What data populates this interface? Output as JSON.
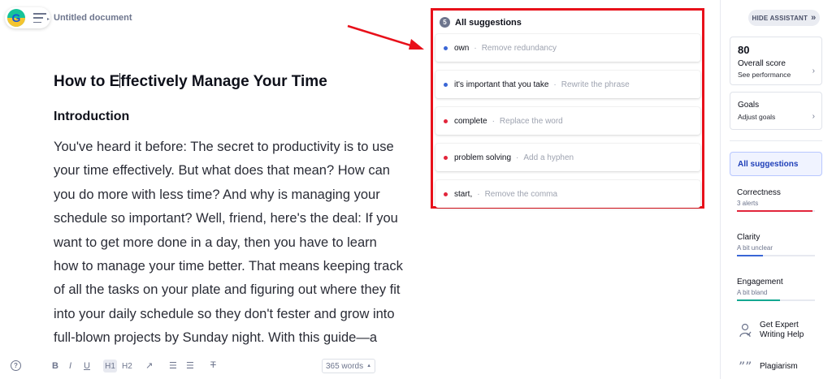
{
  "header": {
    "doc_title": "Untitled document"
  },
  "document": {
    "heading_before_caret": "How to E",
    "heading_after_caret": "ffectively Manage Your Time",
    "subheading": "Introduction",
    "paragraph": "You've heard it before: The secret to productivity is to use your time effectively. But what does that mean? How can you do more with less time? And why is managing your schedule so important? Well, friend, here's the deal: If you want to get more done in a day, then you have to learn how to manage your time better. That means keeping track of all the tasks on your plate and figuring out where they fit into your daily schedule so they don't fester and grow into full-blown projects by Sunday night. With this guide—a compilation of tips collected from"
  },
  "toolbar": {
    "help": "?",
    "bold": "B",
    "italic": "I",
    "underline": "U",
    "h1": "H1",
    "h2": "H2",
    "link_icon": "↗",
    "ordered_list": "☰",
    "bullet_list": "☰",
    "clear_format": "T",
    "word_count": "365 words",
    "word_count_toggle": "▲"
  },
  "suggestions": {
    "count": "5",
    "title": "All suggestions",
    "separator": "·",
    "items": [
      {
        "word": "own",
        "action": "Remove redundancy",
        "color": "#3a66d6"
      },
      {
        "word": "it's important that you take",
        "action": "Rewrite the phrase",
        "color": "#3a66d6"
      },
      {
        "word": "complete",
        "action": "Replace the word",
        "color": "#e2253b"
      },
      {
        "word": "problem solving",
        "action": "Add a hyphen",
        "color": "#e2253b"
      },
      {
        "word": "start,",
        "action": "Remove the comma",
        "color": "#e2253b"
      }
    ]
  },
  "sidebar": {
    "hide_button": "HIDE ASSISTANT",
    "hide_icon": "»",
    "score": "80",
    "score_label": "Overall score",
    "score_link": "See performance",
    "goals_title": "Goals",
    "goals_link": "Adjust goals",
    "chevron": "›",
    "all_suggestions": "All suggestions",
    "categories": [
      {
        "title": "Correctness",
        "sub": "3 alerts",
        "color": "#e2253b",
        "fill": 0.97
      },
      {
        "title": "Clarity",
        "sub": "A bit unclear",
        "color": "#3a66d6",
        "fill": 0.33
      },
      {
        "title": "Engagement",
        "sub": "A bit bland",
        "color": "#14a891",
        "fill": 0.55
      }
    ],
    "expert_label_1": "Get Expert",
    "expert_label_2": "Writing Help",
    "expert_icon": "expert-icon",
    "plagiarism_label": "Plagiarism",
    "plagiarism_icon": "quote-icon"
  },
  "annotation": {
    "box_color": "#e8101a",
    "arrow_color": "#e8101a"
  }
}
